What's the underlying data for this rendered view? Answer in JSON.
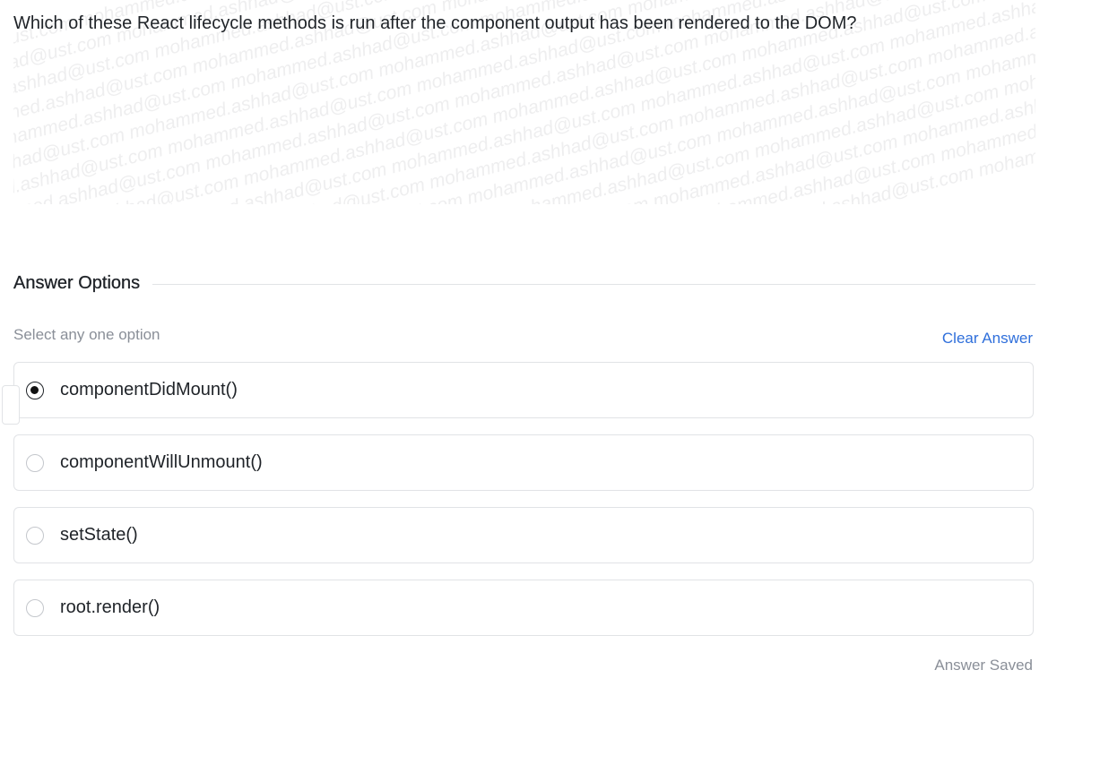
{
  "question": {
    "text": "Which of these React lifecycle methods is run after the component output has been rendered to the DOM?"
  },
  "watermark": {
    "text": "mohammed.ashhad@ust.com"
  },
  "answer_section": {
    "title": "Answer Options",
    "hint": "Select any one option",
    "clear_label": "Clear Answer",
    "status": "Answer Saved"
  },
  "options": [
    {
      "label": "componentDidMount()",
      "selected": true
    },
    {
      "label": "componentWillUnmount()",
      "selected": false
    },
    {
      "label": "setState()",
      "selected": false
    },
    {
      "label": "root.render()",
      "selected": false
    }
  ],
  "colors": {
    "accent": "#2f6fdb",
    "muted_text": "#8a8f98",
    "border": "#e1e3e6"
  }
}
